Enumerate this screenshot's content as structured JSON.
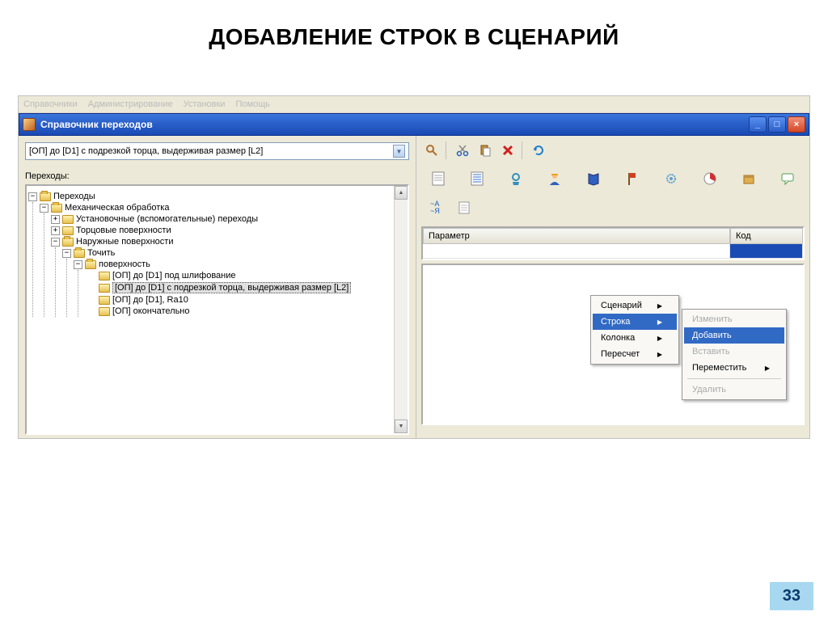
{
  "slide": {
    "title": "ДОБАВЛЕНИЕ СТРОК В СЦЕНАРИЙ",
    "page_number": "33"
  },
  "menubar": {
    "items": [
      "Справочники",
      "Администрирование",
      "Установки",
      "Помощь"
    ]
  },
  "window": {
    "title": "Справочник переходов"
  },
  "dropdown": {
    "value": "[ОП] до [D1]  с подрезкой торца, выдерживая размер [L2]"
  },
  "labels": {
    "transitions": "Переходы:"
  },
  "tree": {
    "root": "Переходы",
    "n1": "Механическая обработка",
    "n1a": "Установочные (вспомогательные) переходы",
    "n1b": "Торцовые поверхности",
    "n1c": "Наружные поверхности",
    "n1c1": "Точить",
    "n1c1a": "поверхность",
    "leaf1": "[ОП] до [D1] под шлифование",
    "leaf2": "[ОП] до [D1]  с подрезкой торца, выдерживая размер [L2]",
    "leaf3": "[ОП] до [D1], Ra10",
    "leaf4": "[ОП] окончательно"
  },
  "table": {
    "col_param": "Параметр",
    "col_code": "Код"
  },
  "context_menu1": {
    "item1": "Сценарий",
    "item2": "Строка",
    "item3": "Колонка",
    "item4": "Пересчет"
  },
  "context_menu2": {
    "item1": "Изменить",
    "item2": "Добавить",
    "item3": "Вставить",
    "item4": "Переместить",
    "item5": "Удалить"
  },
  "icons": {
    "search": "search",
    "cut": "cut",
    "paste": "paste",
    "delete": "delete",
    "refresh": "refresh",
    "sort": "~А\n~Я"
  }
}
